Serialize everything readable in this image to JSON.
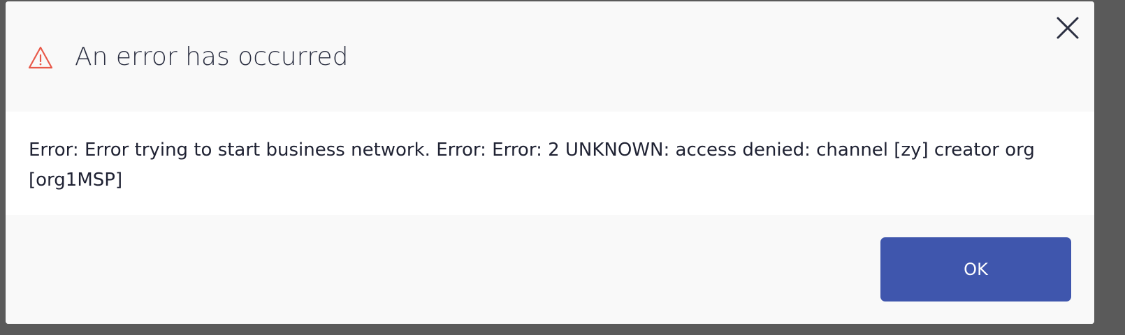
{
  "dialog": {
    "title": "An error has occurred",
    "message": "Error: Error trying to start business network. Error: Error: 2 UNKNOWN: access denied: channel [zy] creator org [org1MSP]",
    "ok_label": "OK",
    "icons": {
      "warning": "warning-triangle-icon",
      "close": "close-icon"
    }
  },
  "colors": {
    "warning": "#e8594a",
    "primary_button": "#3f56ad",
    "text": "#1f2233",
    "header_background": "#f9f9f9",
    "body_background": "#ffffff"
  }
}
